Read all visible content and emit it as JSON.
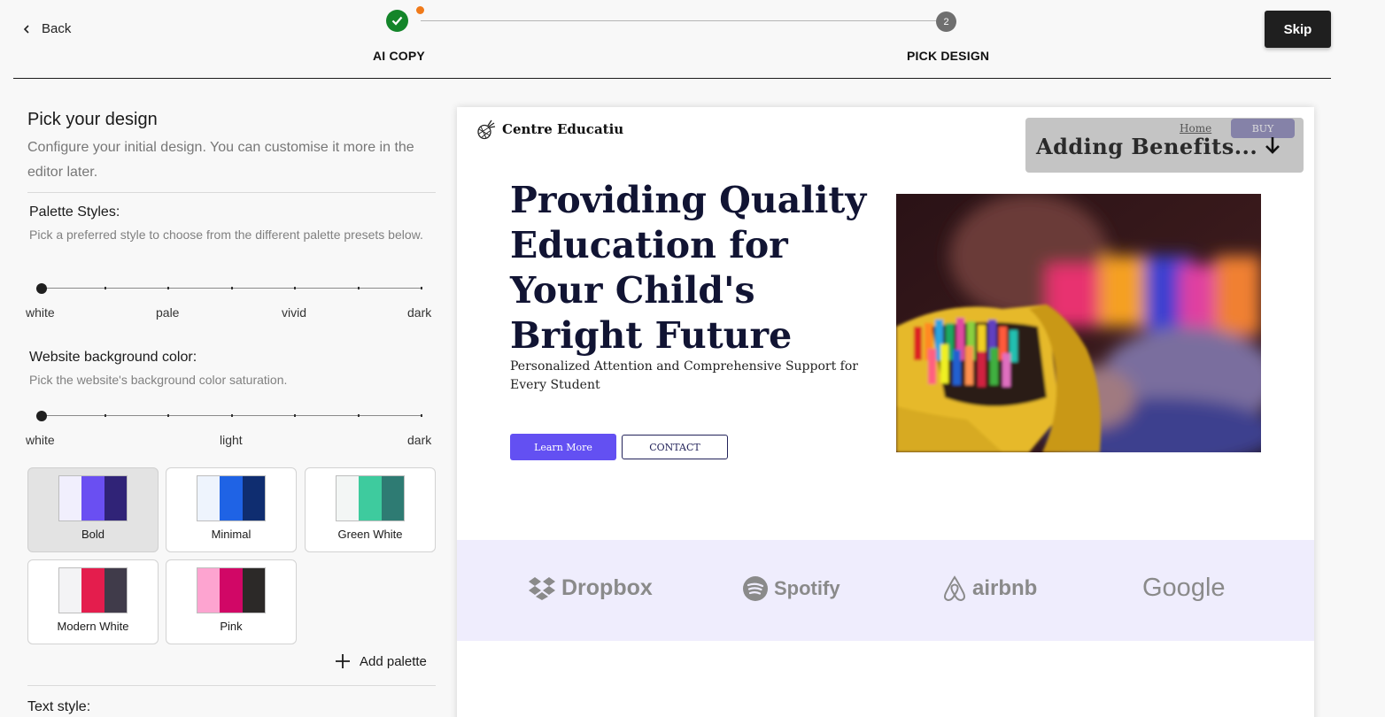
{
  "nav": {
    "back_label": "Back",
    "skip_label": "Skip",
    "steps": [
      {
        "label": "AI COPY",
        "status": "complete"
      },
      {
        "label": "PICK DESIGN",
        "number": "2",
        "status": "current"
      }
    ]
  },
  "panel": {
    "title": "Pick your design",
    "description": "Configure your initial design. You can customise it more in the editor later.",
    "palette_styles": {
      "title": "Palette Styles:",
      "description": "Pick a preferred style to choose from the different palette presets below.",
      "options": [
        "white",
        "pale",
        "vivid",
        "dark"
      ],
      "selected": "white"
    },
    "background_color": {
      "title": "Website background color:",
      "description": "Pick the website's background color saturation.",
      "options": [
        "white",
        "light",
        "dark"
      ],
      "selected": "white"
    },
    "palettes": [
      {
        "name": "Bold",
        "colors": [
          "#f1effd",
          "#6a4ff2",
          "#302377"
        ],
        "selected": true
      },
      {
        "name": "Minimal",
        "colors": [
          "#eef4fd",
          "#1f63e5",
          "#0f2d70"
        ],
        "selected": false
      },
      {
        "name": "Green White",
        "colors": [
          "#f3f6f5",
          "#3ecb9e",
          "#2e7b73"
        ],
        "selected": false
      },
      {
        "name": "Modern White",
        "colors": [
          "#f3f3f5",
          "#e41d4d",
          "#403b4a"
        ],
        "selected": false
      },
      {
        "name": "Pink",
        "colors": [
          "#fda4d0",
          "#d10766",
          "#2c2928"
        ],
        "selected": false
      }
    ],
    "add_palette_label": "Add palette",
    "text_style_title": "Text style:"
  },
  "preview": {
    "brand": "Centre Educatiu",
    "nav_home": "Home",
    "nav_buy": "BUY",
    "loading_text": "Adding Benefits...",
    "hero_title": "Providing Quality Education for Your Child's Bright Future",
    "hero_subtitle": "Personalized Attention and Comprehensive Support for Every Student",
    "learn_more": "Learn More",
    "contact": "CONTACT",
    "logos": [
      "Dropbox",
      "Spotify",
      "airbnb",
      "Google"
    ]
  },
  "colors": {
    "accent": "#6350f2",
    "success": "#14852a",
    "step_dot": "#f07a1a",
    "logo_band": "#efedfd"
  }
}
